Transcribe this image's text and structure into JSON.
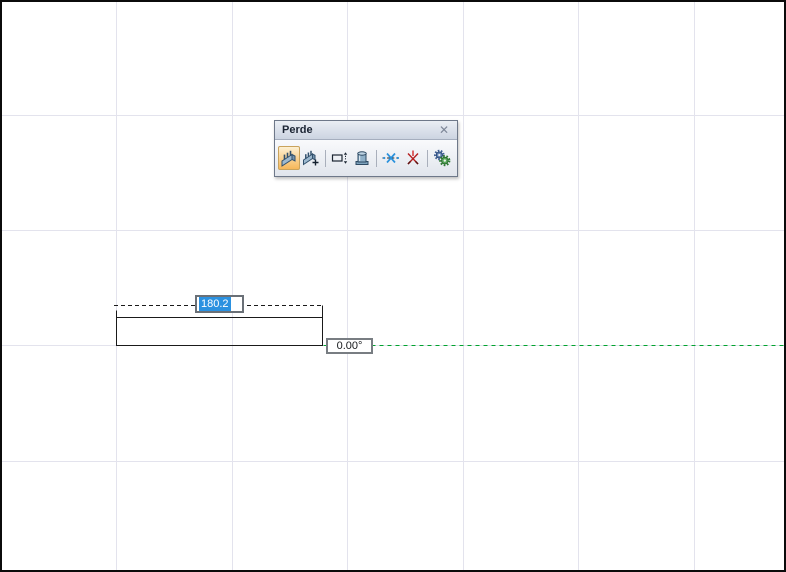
{
  "toolbar": {
    "title": "Perde",
    "close_glyph": "✕",
    "buttons": [
      {
        "name": "curtain-wall-tool",
        "icon": "curtain-wall-icon",
        "active": true
      },
      {
        "name": "curtain-wall-add-tool",
        "icon": "curtain-wall-add-icon",
        "active": false
      },
      {
        "name": "profile-height-tool",
        "icon": "profile-height-icon",
        "active": false
      },
      {
        "name": "post-tool",
        "icon": "post-icon",
        "active": false
      },
      {
        "name": "intersection-tool",
        "icon": "axis-intersection-icon",
        "active": false
      },
      {
        "name": "break-intersection-tool",
        "icon": "break-intersection-icon",
        "active": false
      },
      {
        "name": "settings-tool",
        "icon": "gears-icon",
        "active": false
      }
    ]
  },
  "tracker": {
    "length_value": "180.2",
    "angle_value": "0.00°"
  },
  "canvas": {
    "guide_line_color": "#00a32e",
    "selection_color": "#2b91e0",
    "grid_color": "#e3e3ed",
    "wall_outline_color": "#1a1a1a"
  }
}
